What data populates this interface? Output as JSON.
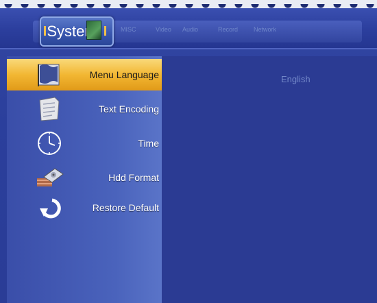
{
  "header": {
    "active_tab": "System",
    "tabs": [
      "MISC",
      "Video",
      "Audio",
      "Record",
      "Network"
    ]
  },
  "menu": {
    "items": [
      {
        "label": "Menu Language",
        "icon": "flag-icon",
        "selected": true
      },
      {
        "label": "Text Encoding",
        "icon": "document-icon",
        "selected": false
      },
      {
        "label": "Time",
        "icon": "clock-icon",
        "selected": false
      },
      {
        "label": "Hdd Format",
        "icon": "hard-disk-icon",
        "selected": false
      },
      {
        "label": "Restore Default",
        "icon": "restore-arrow-icon",
        "selected": false
      }
    ]
  },
  "content": {
    "value": "English"
  },
  "colors": {
    "background": "#2a3d96",
    "selected_highlight": "#f2b733",
    "value_text": "#7388c9"
  }
}
